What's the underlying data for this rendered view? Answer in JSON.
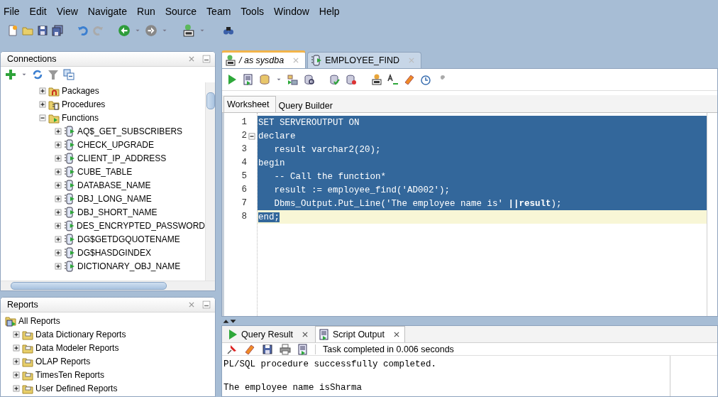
{
  "menu": [
    "File",
    "Edit",
    "View",
    "Navigate",
    "Run",
    "Source",
    "Team",
    "Tools",
    "Window",
    "Help"
  ],
  "connections": {
    "title": "Connections",
    "tree": [
      {
        "label": "Packages",
        "kind": "packages",
        "expanded": false
      },
      {
        "label": "Procedures",
        "kind": "procedures",
        "expanded": false
      },
      {
        "label": "Functions",
        "kind": "functions",
        "expanded": true,
        "children": [
          {
            "label": "AQ$_GET_SUBSCRIBERS",
            "kind": "function",
            "expanded": false
          },
          {
            "label": "CHECK_UPGRADE",
            "kind": "function",
            "expanded": false
          },
          {
            "label": "CLIENT_IP_ADDRESS",
            "kind": "function",
            "expanded": false
          },
          {
            "label": "CUBE_TABLE",
            "kind": "function",
            "expanded": false
          },
          {
            "label": "DATABASE_NAME",
            "kind": "function",
            "expanded": false
          },
          {
            "label": "DBJ_LONG_NAME",
            "kind": "function",
            "expanded": false
          },
          {
            "label": "DBJ_SHORT_NAME",
            "kind": "function",
            "expanded": false
          },
          {
            "label": "DES_ENCRYPTED_PASSWORD",
            "kind": "function",
            "expanded": false
          },
          {
            "label": "DG$GETDGQUOTENAME",
            "kind": "function",
            "expanded": false
          },
          {
            "label": "DG$HASDGINDEX",
            "kind": "function",
            "expanded": false
          },
          {
            "label": "DICTIONARY_OBJ_NAME",
            "kind": "function",
            "expanded": false
          }
        ]
      }
    ]
  },
  "reports": {
    "title": "Reports",
    "tree": [
      {
        "label": "All Reports",
        "kind": "root",
        "children": [
          {
            "label": "Data Dictionary Reports",
            "kind": "folder",
            "expanded": false
          },
          {
            "label": "Data Modeler Reports",
            "kind": "folder",
            "expanded": false
          },
          {
            "label": "OLAP Reports",
            "kind": "folder",
            "expanded": false
          },
          {
            "label": "TimesTen Reports",
            "kind": "folder",
            "expanded": false
          },
          {
            "label": "User Defined Reports",
            "kind": "folder",
            "expanded": false
          }
        ]
      }
    ]
  },
  "editor": {
    "tabs": [
      {
        "label": "/ as sysdba",
        "kind": "sql",
        "selected": true
      },
      {
        "label": "EMPLOYEE_FIND",
        "kind": "function",
        "selected": false
      }
    ],
    "subtabs": [
      {
        "label": "Worksheet",
        "selected": true
      },
      {
        "label": "Query Builder",
        "selected": false
      }
    ],
    "lines": [
      {
        "number": "1",
        "text": "SET SERVEROUTPUT ON",
        "selected": true,
        "current": false,
        "foldable": false
      },
      {
        "number": "2",
        "text": "declare",
        "selected": true,
        "current": false,
        "foldable": true
      },
      {
        "number": "3",
        "text": "   result varchar2(20);",
        "selected": true,
        "current": false,
        "foldable": false
      },
      {
        "number": "4",
        "text": "begin",
        "selected": true,
        "current": false,
        "foldable": false
      },
      {
        "number": "5",
        "text": "   -- Call the function*",
        "selected": true,
        "current": false,
        "foldable": false
      },
      {
        "number": "6",
        "text": "   result := employee_find('AD002');",
        "selected": true,
        "current": false,
        "foldable": false
      },
      {
        "number": "7",
        "text": "   Dbms_Output.Put_Line('The employee name is' **||result**);",
        "selected": true,
        "current": false,
        "foldable": false
      },
      {
        "number": "8",
        "text": "end;",
        "selected": true,
        "current": true,
        "foldable": false
      }
    ]
  },
  "results": {
    "tabs": [
      {
        "label": "Query Result",
        "kind": "query",
        "selected": false
      },
      {
        "label": "Script Output",
        "kind": "script",
        "selected": true
      }
    ],
    "status": "Task completed in 0.006 seconds",
    "output": [
      "PL/SQL procedure successfully completed.",
      "The employee name isSharma"
    ]
  }
}
